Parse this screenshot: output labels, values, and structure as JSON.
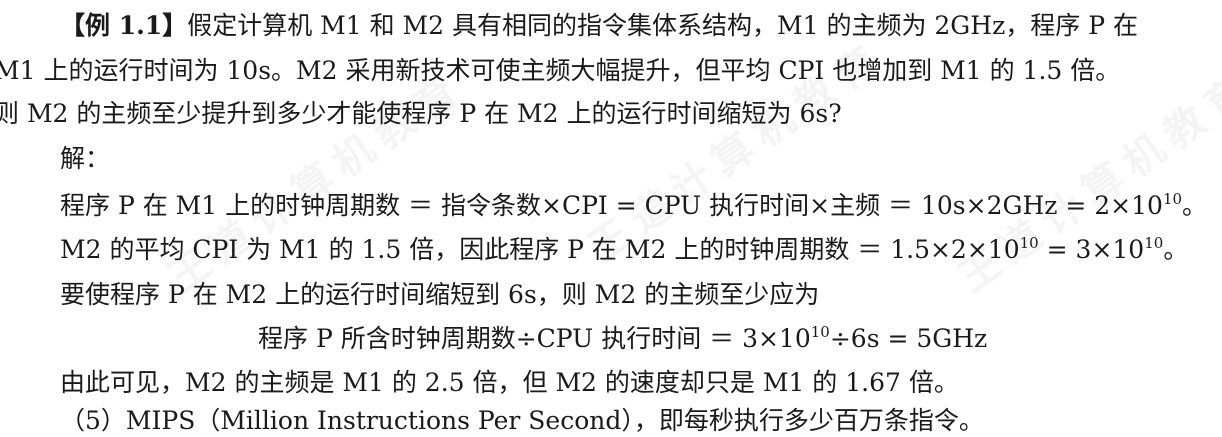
{
  "watermark": {
    "text": "王道计算机教育"
  },
  "example": {
    "label": "【例 1.1】",
    "line1_rest": "假定计算机 M1 和 M2 具有相同的指令集体系结构，M1 的主频为 2GHz，程序 P 在",
    "line2": "M1 上的运行时间为 10s。M2 采用新技术可使主频大幅提升，但平均 CPI 也增加到 M1 的 1.5 倍。",
    "line3": "则 M2 的主频至少提升到多少才能使程序 P 在 M2 上的运行时间缩短为 6s?"
  },
  "solution": {
    "heading": "解：",
    "step1_a": "程序 P 在 M1 上的时钟周期数 ＝ 指令条数×CPI = CPU 执行时间×主频 ＝ 10s×2GHz = 2×10",
    "step1_exp": "10",
    "step1_end": "。",
    "step2_a": "M2 的平均 CPI 为 M1 的 1.5 倍，因此程序 P 在 M2 上的时钟周期数 ＝ 1.5×2×10",
    "step2_exp1": "10",
    "step2_b": " = 3×10",
    "step2_exp2": "10",
    "step2_end": "。",
    "step3": "要使程序 P 在 M2 上的运行时间缩短到 6s，则 M2 的主频至少应为",
    "formula_a": "程序 P 所含时钟周期数÷CPU 执行时间 ＝ 3×10",
    "formula_exp": "10",
    "formula_b": "÷6s = 5GHz",
    "conclusion": "由此可见，M2 的主频是 M1 的 2.5 倍，但 M2 的速度却只是 M1 的 1.67 倍。"
  },
  "next_section": {
    "text": "（5）MIPS（Million Instructions Per Second），即每秒执行多少百万条指令。"
  }
}
